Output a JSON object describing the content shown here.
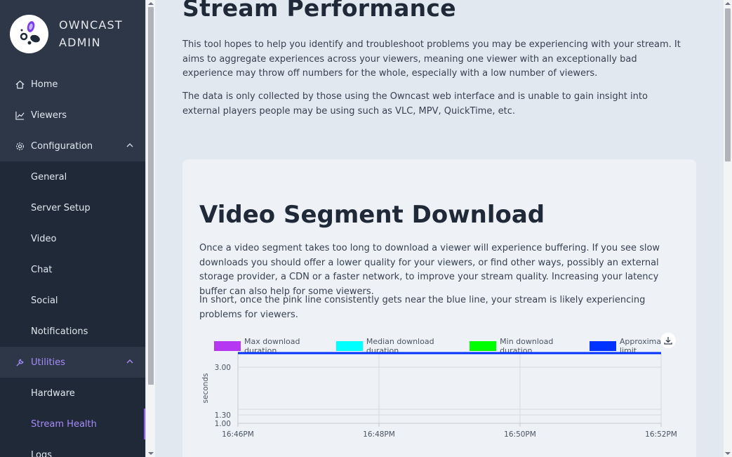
{
  "brand": {
    "line1": "OWNCAST",
    "line2": "ADMIN"
  },
  "sidebar": {
    "items": [
      {
        "label": "Home",
        "icon": "home-icon"
      },
      {
        "label": "Viewers",
        "icon": "line-chart-icon"
      },
      {
        "label": "Configuration",
        "icon": "gear-icon",
        "expanded": true,
        "children": [
          "General",
          "Server Setup",
          "Video",
          "Chat",
          "Social",
          "Notifications"
        ]
      },
      {
        "label": "Utilities",
        "icon": "wrench-icon",
        "expanded": true,
        "active": true,
        "children": [
          "Hardware",
          "Stream Health",
          "Logs"
        ],
        "active_child": "Stream Health"
      }
    ]
  },
  "main": {
    "title": "Stream Performance",
    "intro1": "This tool hopes to help you identify and troubleshoot problems you may be experiencing with your stream. It aims to aggregate experiences across your viewers, meaning one viewer with an exceptionally bad experience may throw off numbers for the whole, especially with a low number of viewers.",
    "intro2": "The data is only collected by those using the Owncast web interface and is unable to gain insight into external players people may be using such as VLC, MPV, QuickTime, etc.",
    "card": {
      "title": "Video Segment Download",
      "p1": "Once a video segment takes too long to download a viewer will experience buffering. If you see slow downloads you should offer a lower quality for your viewers, or find other ways, possibly an external storage provider, a CDN or a faster network, to improve your stream quality. Increasing your latency buffer can also help for some viewers.",
      "p2": "In short, once the pink line consistently gets near the blue line, your stream is likely experiencing problems for viewers."
    }
  },
  "colors": {
    "accent": "#8b5cf6",
    "sidebar_bg": "#2d3748",
    "submenu_bg": "#1f2937"
  },
  "chart_data": {
    "type": "line",
    "ylabel": "seconds",
    "xlabel": "",
    "x": [
      "16:46PM",
      "16:48PM",
      "16:50PM",
      "16:52PM"
    ],
    "yticks": [
      "3.00",
      "1.30",
      "1.00"
    ],
    "series": [
      {
        "name": "Max download duration",
        "color": "#b537f2",
        "values": []
      },
      {
        "name": "Median download duration",
        "color": "#00ffff",
        "values": []
      },
      {
        "name": "Min download duration",
        "color": "#00ff00",
        "values": []
      },
      {
        "name": "Approximate limit",
        "color": "#0033ff",
        "values": [
          3.5,
          3.5,
          3.5,
          3.5
        ]
      }
    ],
    "ylim": [
      1.0,
      3.5
    ],
    "grid": true,
    "legend": "top"
  }
}
